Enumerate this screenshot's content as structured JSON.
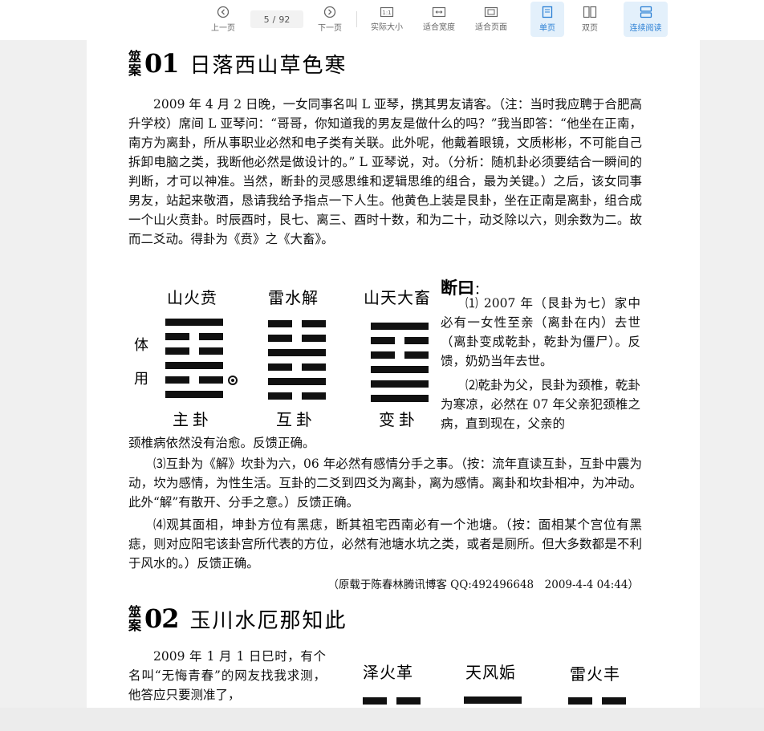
{
  "toolbar": {
    "prev": "上一页",
    "current_page": "5",
    "page_sep": "/",
    "total_pages": "92",
    "next": "下一页",
    "actual_size": "实际大小",
    "fit_width": "适合宽度",
    "fit_page": "适合页面",
    "single_page": "单页",
    "double_page": "双页",
    "continuous": "连续阅读",
    "accent": "#2a7fd4"
  },
  "case1": {
    "mark": "筮案",
    "num": "01",
    "title": "日落西山草色寒",
    "p1": "2009 年 4 月 2 日晚，一女同事名叫 L 亚琴，携其男友请客。（注：当时我应聘于合肥高升学校）席间 L 亚琴问：“哥哥，你知道我的男友是做什么的吗？”我当即答：“他坐在正南，南方为离卦，所从事职业必然和电子类有关联。此外呢，他戴着眼镜，文质彬彬，不可能自己拆卸电脑之类，我断他必然是做设计的。” L 亚琴说，对。（分析：随机卦必须要结合一瞬间的判断，才可以神准。当然，断卦的灵感思维和逻辑思维的组合，最为关键。）之后，该女同事男友，站起来敬酒，恳请我给予指点一下人生。他黄色上装是艮卦，坐在正南是离卦，组合成一个山火贲卦。时辰酉时，艮七、离三、酉时十数，和为二十，动爻除以六，则余数为二。故而二爻动。得卦为《贲》之《大畜》。",
    "hex_names": [
      "山火贲",
      "雷水解",
      "山天大畜"
    ],
    "hex_captions": [
      "主卦",
      "互卦",
      "变卦"
    ],
    "ti": "体",
    "yong": "用",
    "judge_title": "断曰",
    "judge_colon": "：",
    "j1": "⑴ 2007 年（艮卦为七）家中必有一女性至亲（离卦在内）去世（离卦变成乾卦，乾卦为僵尸）。反馈，奶奶当年去世。",
    "j2": "⑵乾卦为父，艮卦为颈椎，乾卦为寒凉，必然在 07 年父亲犯颈椎之病，直到现在，父亲的",
    "j2_cont": "颈椎病依然没有治愈。反馈正确。",
    "j3": "⑶互卦为《解》坎卦为六，06 年必然有感情分手之事。（按：流年直读互卦，互卦中震为动，坎为感情，为性生活。互卦的二爻到四爻为离卦，离为感情。离卦和坎卦相冲，为冲动。此外“解”有散开、分手之意。）反馈正确。",
    "j4": "⑷观其面相，坤卦方位有黑痣，断其祖宅西南必有一个池塘。（按：面相某个宫位有黑痣，则对应阳宅该卦宫所代表的方位，必然有池塘水坑之类，或者是厕所。但大多数都是不利于风水的。）反馈正确。",
    "source": "（原载于陈春林腾讯博客 QQ:492496648　2009-4-4 04:44）"
  },
  "case2": {
    "mark": "筮案",
    "num": "02",
    "title": "玉川水厄那知此",
    "p1": "2009 年 1 月 1 日巳时，有个名叫“无悔青春”的网友找我求测，他答应只要测准了，",
    "hex_names": [
      "泽火革",
      "天风姤",
      "雷火丰"
    ]
  }
}
